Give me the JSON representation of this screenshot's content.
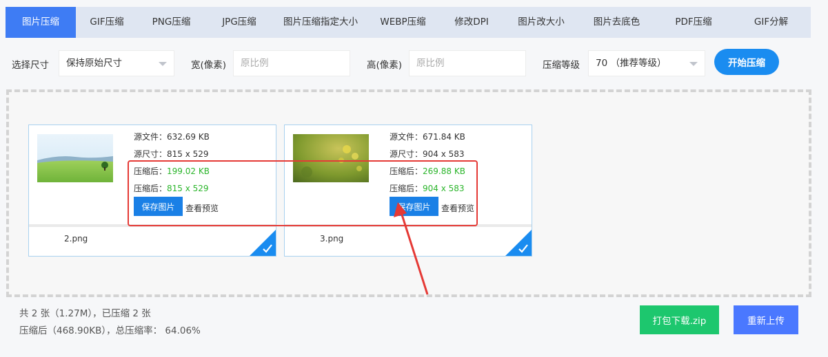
{
  "tabs": [
    {
      "label": "图片压缩",
      "active": true
    },
    {
      "label": "GIF压缩"
    },
    {
      "label": "PNG压缩"
    },
    {
      "label": "JPG压缩"
    },
    {
      "label": "图片压缩指定大小"
    },
    {
      "label": "WEBP压缩"
    },
    {
      "label": "修改DPI"
    },
    {
      "label": "图片改大小"
    },
    {
      "label": "图片去底色"
    },
    {
      "label": "PDF压缩"
    },
    {
      "label": "GIF分解"
    }
  ],
  "options": {
    "size_label": "选择尺寸",
    "size_value": "保持原始尺寸",
    "width_label": "宽(像素)",
    "width_placeholder": "原比例",
    "height_label": "高(像素)",
    "height_placeholder": "原比例",
    "level_label": "压缩等级",
    "level_value": "70 （推荐等级）",
    "start_button": "开始压缩"
  },
  "cards": [
    {
      "source_file": "源文件：632.69 KB",
      "source_size": "源尺寸：815 x 529",
      "compressed_file_label": "压缩后：",
      "compressed_file_value": "199.02 KB",
      "compressed_size_label": "压缩后：",
      "compressed_size_value": "815 x 529",
      "save_button": "保存图片",
      "preview_link": "查看预览",
      "filename": "2.png"
    },
    {
      "source_file": "源文件：671.84 KB",
      "source_size": "源尺寸：904 x 583",
      "compressed_file_label": "压缩后：",
      "compressed_file_value": "269.88 KB",
      "compressed_size_label": "压缩后：",
      "compressed_size_value": "904 x 583",
      "save_button": "保存图片",
      "preview_link": "查看预览",
      "filename": "3.png"
    }
  ],
  "summary": {
    "line1": "共 2 张（1.27M），已压缩 2 张",
    "line2": "压缩后（468.90KB），总压缩率： 64.06%"
  },
  "actions": {
    "zip_button": "打包下载.zip",
    "reupload_button": "重新上传"
  },
  "colors": {
    "accent": "#3e7cf4",
    "success_text": "#2bb52b",
    "annotation": "#e53935"
  }
}
